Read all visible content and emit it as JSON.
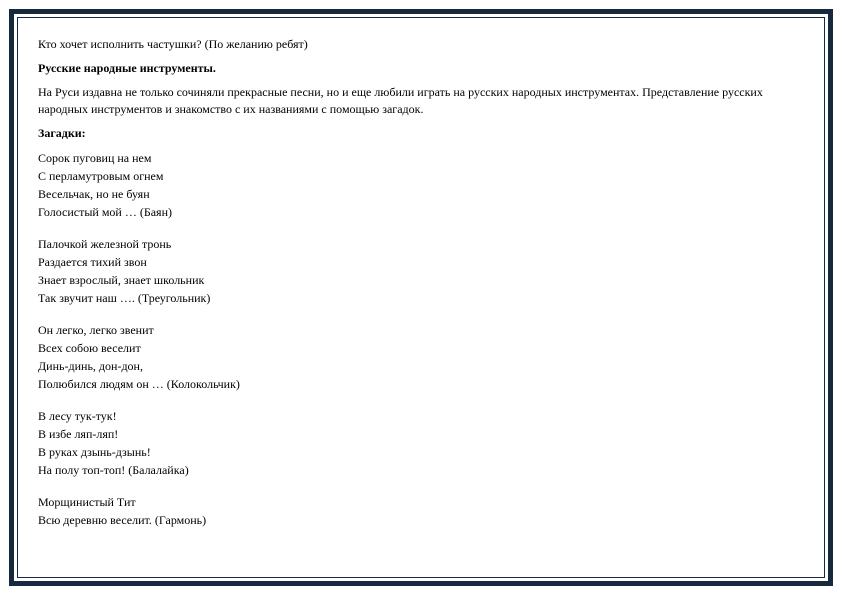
{
  "intro_question": "Кто хочет исполнить частушки? (По желанию ребят)",
  "heading1": "Русские народные инструменты.",
  "para1": "На Руси издавна не только сочиняли прекрасные песни, но и еще любили играть на русских народных инструментах. Представление русских народных инструментов и знакомство с их названиями с помощью загадок.",
  "heading2": "Загадки:",
  "riddles": [
    {
      "lines": [
        "Сорок пуговиц на нем",
        "С перламутровым огнем",
        "Весельчак, но не буян",
        "Голосистый мой … (Баян)"
      ]
    },
    {
      "lines": [
        "Палочкой железной тронь",
        "Раздается тихий звон",
        "Знает взрослый, знает школьник",
        "Так звучит наш …. (Треугольник)"
      ]
    },
    {
      "lines": [
        "Он легко, легко звенит",
        "Всех собою веселит",
        "Динь-динь, дон-дон,",
        "Полюбился людям он … (Колокольчик)"
      ]
    },
    {
      "lines": [
        "В лесу тук-тук!",
        "В избе ляп-ляп!",
        "В руках дзынь-дзынь!",
        "На полу топ-топ! (Балалайка)"
      ]
    },
    {
      "lines": [
        "Морщинистый Тит",
        "Всю деревню веселит. (Гармонь)"
      ]
    }
  ]
}
